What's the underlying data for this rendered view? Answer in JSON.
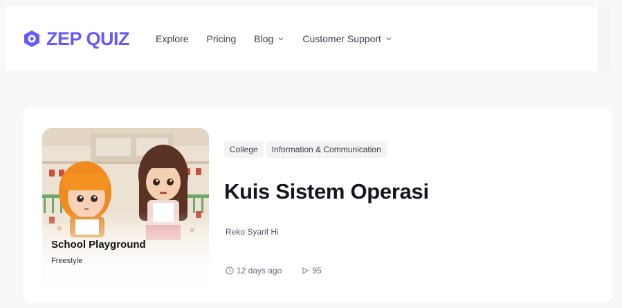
{
  "brand": {
    "name": "ZEP QUIZ",
    "color": "#6758ff"
  },
  "nav": {
    "items": [
      {
        "label": "Explore",
        "has_dropdown": false
      },
      {
        "label": "Pricing",
        "has_dropdown": false
      },
      {
        "label": "Blog",
        "has_dropdown": true
      },
      {
        "label": "Customer Support",
        "has_dropdown": true
      }
    ]
  },
  "quiz": {
    "thumbnail": {
      "map_name": "School Playground",
      "mode": "Freestyle"
    },
    "tags": [
      "College",
      "Information & Communication"
    ],
    "title": "Kuis Sistem Operasi",
    "author": "Reko Syarif Hi",
    "time_ago": "12 days ago",
    "plays": "95"
  },
  "icons": {
    "logo": "zep-logo-icon",
    "clock": "clock-icon",
    "plays": "play-icon",
    "dropdown": "chevron-down-icon"
  }
}
